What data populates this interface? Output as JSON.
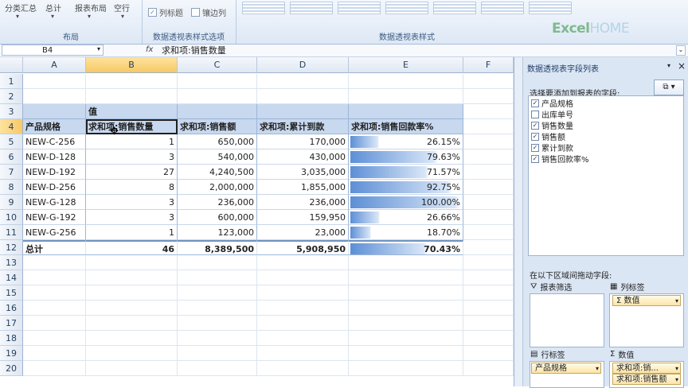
{
  "ribbon": {
    "layout_group": {
      "label": "布局",
      "buttons": [
        "分类汇总",
        "总计",
        "报表布局",
        "空行"
      ]
    },
    "options_group": {
      "label": "数据透视表样式选项",
      "row_headers_label": "列标题",
      "banded_rows_label": "镶边列"
    },
    "styles_group": {
      "label": "数据透视表样式"
    },
    "logo": {
      "main": "Excel",
      "suffix": "HOME"
    }
  },
  "formula_bar": {
    "name_box": "B4",
    "fx_icon": "fx",
    "formula": "求和项:销售数量"
  },
  "sheet": {
    "columns": [
      "A",
      "B",
      "C",
      "D",
      "E",
      "F"
    ],
    "rows": [
      "1",
      "2",
      "3",
      "4",
      "5",
      "6",
      "7",
      "8",
      "9",
      "10",
      "11",
      "12",
      "13",
      "14",
      "15",
      "16",
      "17",
      "18",
      "19",
      "20"
    ],
    "pivot": {
      "values_header": "值",
      "headers": [
        "产品规格",
        "求和项:销售数量",
        "求和项:销售额",
        "求和项:累计到款",
        "求和项:销售回款率%"
      ],
      "rows": [
        {
          "product": "NEW-C-256",
          "qty": "1",
          "sales": "650,000",
          "received": "170,000",
          "rate": "26.15%",
          "rate_value": 26.15
        },
        {
          "product": "NEW-D-128",
          "qty": "3",
          "sales": "540,000",
          "received": "430,000",
          "rate": "79.63%",
          "rate_value": 79.63
        },
        {
          "product": "NEW-D-192",
          "qty": "27",
          "sales": "4,240,500",
          "received": "3,035,000",
          "rate": "71.57%",
          "rate_value": 71.57
        },
        {
          "product": "NEW-D-256",
          "qty": "8",
          "sales": "2,000,000",
          "received": "1,855,000",
          "rate": "92.75%",
          "rate_value": 92.75
        },
        {
          "product": "NEW-G-128",
          "qty": "3",
          "sales": "236,000",
          "received": "236,000",
          "rate": "100.00%",
          "rate_value": 100
        },
        {
          "product": "NEW-G-192",
          "qty": "3",
          "sales": "600,000",
          "received": "159,950",
          "rate": "26.66%",
          "rate_value": 26.66
        },
        {
          "product": "NEW-G-256",
          "qty": "1",
          "sales": "123,000",
          "received": "23,000",
          "rate": "18.70%",
          "rate_value": 18.7
        }
      ],
      "total": {
        "label": "总计",
        "qty": "46",
        "sales": "8,389,500",
        "received": "5,908,950",
        "rate": "70.43%",
        "rate_value": 70.43
      }
    },
    "databar_color": "#5d8fd6",
    "header_fill": "#c7d8ef"
  },
  "field_panel": {
    "title": "数据透视表字段列表",
    "choose_label": "选择要添加到报表的字段:",
    "layout_icon": "layout-icon",
    "fields": [
      {
        "name": "产品规格",
        "checked": true
      },
      {
        "name": "出库单号",
        "checked": false
      },
      {
        "name": "销售数量",
        "checked": true
      },
      {
        "name": "销售额",
        "checked": true
      },
      {
        "name": "累计到款",
        "checked": true
      },
      {
        "name": "销售回款率%",
        "checked": true
      }
    ],
    "drag_label": "在以下区域间拖动字段:",
    "areas": {
      "report_filter": "报表筛选",
      "column_labels": "列标签",
      "row_labels": "行标签",
      "values": "数值",
      "column_chip": "数值",
      "row_chip": "产品规格",
      "value_chips": [
        "求和项:销...",
        "求和项:销售额"
      ]
    }
  }
}
